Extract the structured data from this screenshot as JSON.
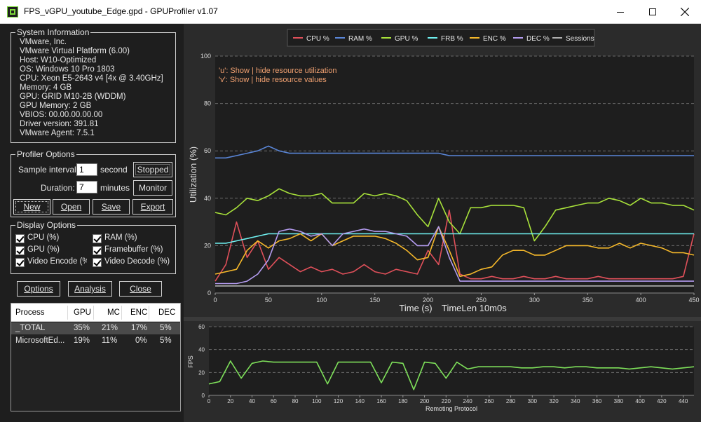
{
  "window": {
    "title": "FPS_vGPU_youtube_Edge.gpd - GPUProfiler v1.07",
    "min_symbol": "—",
    "max_symbol": "☐",
    "close_symbol": "✕"
  },
  "system_info": {
    "title": "System Information",
    "lines": [
      "VMware, Inc.",
      "VMware Virtual Platform (6.00)",
      "Host: W10-Optimized",
      "OS: Windows 10 Pro 1803",
      "CPU: Xeon E5-2643 v4 [4x @ 3.40GHz]",
      "Memory: 4 GB",
      "GPU: GRID M10-2B (WDDM)",
      "GPU Memory: 2 GB",
      "VBIOS: 00.00.00.00.00",
      "Driver version: 391.81",
      "VMware Agent: 7.5.1"
    ]
  },
  "profiler_options": {
    "title": "Profiler Options",
    "sample_interval_label": "Sample interval:",
    "sample_interval_value": "1",
    "sample_interval_unit": "second",
    "duration_label": "Duration:",
    "duration_value": "7",
    "duration_unit": "minutes",
    "stopped_button": "Stopped",
    "monitor_button": "Monitor",
    "new_button": "New",
    "open_button": "Open",
    "save_button": "Save",
    "export_button": "Export"
  },
  "display_options": {
    "title": "Display Options",
    "cpu": "CPU (%)",
    "ram": "RAM (%)",
    "gpu": "GPU (%)",
    "framebuffer": "Framebuffer (%)",
    "video_encode": "Video Encode (%)",
    "video_decode": "Video Decode (%)"
  },
  "bottom_buttons": {
    "options": "Options",
    "analysis": "Analysis",
    "close": "Close"
  },
  "process_table": {
    "headers": [
      "Process",
      "GPU",
      "MC",
      "ENC",
      "DEC"
    ],
    "rows": [
      [
        "_TOTAL",
        "35%",
        "21%",
        "17%",
        "5%"
      ],
      [
        "MicrosoftEd...",
        "19%",
        "11%",
        "0%",
        "5%"
      ]
    ]
  },
  "colors": {
    "cpu": "#e0505a",
    "ram": "#5a86d8",
    "gpu": "#a8e23a",
    "frb": "#6ff0f0",
    "enc": "#f5b82a",
    "dec": "#b49cf0",
    "sessions": "#b0b0b0",
    "fps": "#7ee05a",
    "hint": "#f0a070"
  },
  "chart_data": [
    {
      "type": "line",
      "title": "",
      "legend": [
        "CPU %",
        "RAM %",
        "GPU %",
        "FRB %",
        "ENC %",
        "DEC %",
        "Sessions"
      ],
      "legend_position": "top",
      "ylabel": "Utilization (%)",
      "xlabel": "Time (s)",
      "xlabel_extra": "TimeLen 10m0s",
      "hint_lines": [
        "'u': Show | hide resource utilization",
        "'v': Show | hide resource values"
      ],
      "xlim": [
        0,
        450
      ],
      "ylim": [
        0,
        100
      ],
      "x_ticks": [
        0,
        50,
        100,
        150,
        200,
        250,
        300,
        350,
        400,
        450
      ],
      "y_ticks": [
        0,
        20,
        40,
        60,
        80,
        100
      ],
      "grid": "horizontal",
      "x": [
        0,
        10,
        20,
        30,
        40,
        50,
        60,
        70,
        80,
        90,
        100,
        110,
        120,
        130,
        140,
        150,
        160,
        170,
        180,
        190,
        200,
        210,
        220,
        230,
        240,
        250,
        260,
        270,
        280,
        290,
        300,
        310,
        320,
        330,
        340,
        350,
        360,
        370,
        380,
        390,
        400,
        410,
        420,
        430,
        440,
        450
      ],
      "series": [
        {
          "name": "CPU %",
          "values": [
            5,
            12,
            30,
            15,
            22,
            10,
            15,
            12,
            9,
            11,
            9,
            10,
            8,
            9,
            12,
            9,
            8,
            10,
            9,
            8,
            18,
            12,
            35,
            8,
            6,
            6,
            7,
            6,
            6,
            7,
            6,
            6,
            7,
            6,
            6,
            6,
            7,
            6,
            6,
            6,
            6,
            6,
            6,
            6,
            7,
            25
          ]
        },
        {
          "name": "RAM %",
          "values": [
            57,
            57,
            58,
            59,
            60,
            62,
            60,
            59,
            59,
            59,
            59,
            59,
            59,
            59,
            59,
            59,
            59,
            59,
            59,
            59,
            59,
            59,
            58,
            58,
            58,
            58,
            58,
            58,
            58,
            58,
            58,
            58,
            58,
            58,
            58,
            58,
            58,
            58,
            58,
            58,
            58,
            58,
            58,
            58,
            58,
            58
          ]
        },
        {
          "name": "GPU %",
          "values": [
            34,
            33,
            36,
            40,
            39,
            41,
            44,
            42,
            41,
            41,
            42,
            38,
            38,
            38,
            42,
            41,
            42,
            41,
            39,
            33,
            28,
            40,
            30,
            25,
            36,
            36,
            37,
            37,
            37,
            36,
            22,
            28,
            35,
            36,
            37,
            38,
            38,
            40,
            39,
            37,
            40,
            38,
            38,
            37,
            37,
            35
          ]
        },
        {
          "name": "FRB %",
          "values": [
            21,
            21,
            22,
            23,
            24,
            25,
            25,
            25,
            25,
            25,
            25,
            25,
            25,
            25,
            25,
            25,
            25,
            25,
            25,
            25,
            25,
            25,
            25,
            25,
            25,
            25,
            25,
            25,
            25,
            25,
            25,
            25,
            25,
            25,
            25,
            25,
            25,
            25,
            25,
            25,
            25,
            25,
            25,
            25,
            25,
            25
          ]
        },
        {
          "name": "ENC %",
          "values": [
            8,
            9,
            10,
            18,
            22,
            19,
            22,
            23,
            25,
            22,
            25,
            20,
            22,
            24,
            24,
            24,
            23,
            21,
            18,
            14,
            15,
            28,
            18,
            7,
            8,
            10,
            11,
            16,
            18,
            18,
            16,
            16,
            18,
            20,
            20,
            20,
            19,
            19,
            21,
            19,
            21,
            20,
            19,
            17,
            17,
            16
          ]
        },
        {
          "name": "DEC %",
          "values": [
            4,
            4,
            4,
            5,
            8,
            14,
            26,
            27,
            26,
            24,
            25,
            20,
            25,
            26,
            27,
            26,
            26,
            25,
            24,
            20,
            20,
            28,
            15,
            5,
            5,
            5,
            5,
            5,
            5,
            5,
            5,
            5,
            5,
            5,
            5,
            5,
            5,
            5,
            5,
            5,
            5,
            5,
            5,
            5,
            5,
            5
          ]
        },
        {
          "name": "Sessions",
          "values": [
            3,
            3,
            3,
            3,
            3,
            3,
            3,
            3,
            3,
            3,
            3,
            3,
            3,
            3,
            3,
            3,
            3,
            3,
            3,
            3,
            3,
            3,
            3,
            3,
            3,
            3,
            3,
            3,
            3,
            3,
            3,
            3,
            3,
            3,
            3,
            3,
            3,
            3,
            3,
            3,
            3,
            3,
            3,
            3,
            3,
            3
          ]
        }
      ]
    },
    {
      "type": "line",
      "title": "",
      "ylabel": "FPS",
      "xlabel": "Remoting Protocol",
      "xlim": [
        0,
        450
      ],
      "ylim": [
        0,
        60
      ],
      "x_ticks": [
        0,
        20,
        40,
        60,
        80,
        100,
        120,
        140,
        160,
        180,
        200,
        220,
        240,
        260,
        280,
        300,
        320,
        340,
        360,
        380,
        400,
        420,
        440
      ],
      "y_ticks": [
        0,
        20,
        40,
        60
      ],
      "grid": "horizontal",
      "x": [
        0,
        10,
        20,
        30,
        40,
        50,
        60,
        70,
        80,
        90,
        100,
        110,
        120,
        130,
        140,
        150,
        160,
        170,
        180,
        190,
        200,
        210,
        220,
        230,
        240,
        250,
        260,
        270,
        280,
        290,
        300,
        310,
        320,
        330,
        340,
        350,
        360,
        370,
        380,
        390,
        400,
        410,
        420,
        430,
        440,
        450
      ],
      "series": [
        {
          "name": "FPS",
          "values": [
            10,
            12,
            30,
            15,
            28,
            30,
            29,
            29,
            29,
            29,
            29,
            10,
            29,
            29,
            29,
            29,
            11,
            29,
            28,
            5,
            29,
            28,
            15,
            29,
            23,
            25,
            25,
            25,
            25,
            24,
            24,
            25,
            25,
            24,
            25,
            25,
            24,
            24,
            24,
            23,
            24,
            25,
            24,
            23,
            24,
            25
          ]
        }
      ]
    }
  ]
}
